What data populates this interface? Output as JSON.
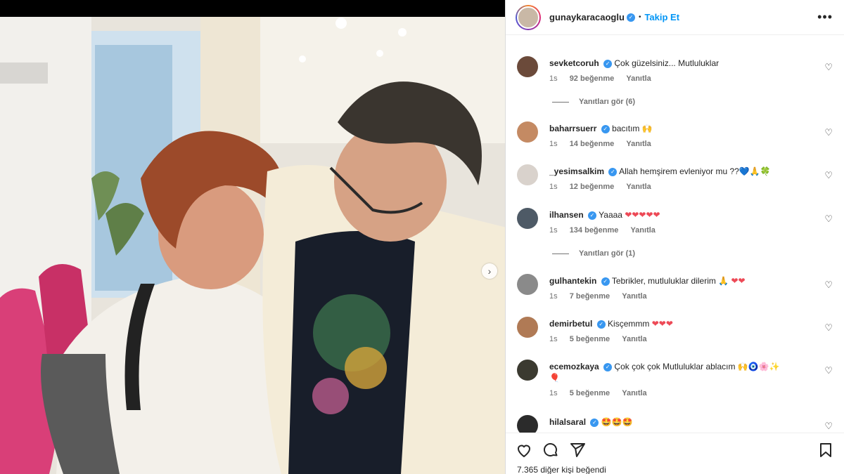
{
  "header": {
    "username": "gunaykaracaoglu",
    "follow_label": "Takip Et",
    "separator": "•",
    "more": "•••"
  },
  "carousel": {
    "next_icon": "›"
  },
  "comments": [
    {
      "user": "sevketcoruh",
      "text": "Çok güzelsiniz... Mutluluklar",
      "time": "1s",
      "likes": "92 beğenme",
      "reply": "Yanıtla",
      "avatar_color": "#6b4a3a"
    },
    {
      "user": "baharrsuerr",
      "text": "bacıtım 🙌",
      "time": "1s",
      "likes": "14 beğenme",
      "reply": "Yanıtla",
      "avatar_color": "#c48a63"
    },
    {
      "user": "_yesimsalkim",
      "text": "Allah hemşirem evleniyor mu ??💙🙏🍀",
      "time": "1s",
      "likes": "12 beğenme",
      "reply": "Yanıtla",
      "avatar_color": "#d9d2cc"
    },
    {
      "user": "ilhansen",
      "text": "Yaaaa",
      "hearts": "❤❤❤❤❤",
      "time": "1s",
      "likes": "134 beğenme",
      "reply": "Yanıtla",
      "avatar_color": "#4e5a66"
    },
    {
      "user": "gulhantekin",
      "text": "Tebrikler, mutluluklar dilerim 🙏",
      "hearts": "❤❤",
      "time": "1s",
      "likes": "7 beğenme",
      "reply": "Yanıtla",
      "avatar_color": "#8a8a8a"
    },
    {
      "user": "demirbetul",
      "text": "Kisçemmm",
      "hearts": "❤❤❤",
      "time": "1s",
      "likes": "5 beğenme",
      "reply": "Yanıtla",
      "avatar_color": "#b07a55"
    },
    {
      "user": "ecemozkaya",
      "text": "Çok çok çok Mutluluklar ablacım 🙌🧿🌸✨",
      "text2": "🎈",
      "time": "1s",
      "likes": "5 beğenme",
      "reply": "Yanıtla",
      "avatar_color": "#3b3a30"
    },
    {
      "user": "hilalsaral",
      "text": "🤩🤩🤩",
      "avatar_color": "#2b2b2b"
    }
  ],
  "view_replies": [
    {
      "label": "Yanıtları gör (6)"
    },
    {
      "label": "Yanıtları gör (1)"
    }
  ],
  "likes_summary": "7.365 diğer kişi beğendi"
}
